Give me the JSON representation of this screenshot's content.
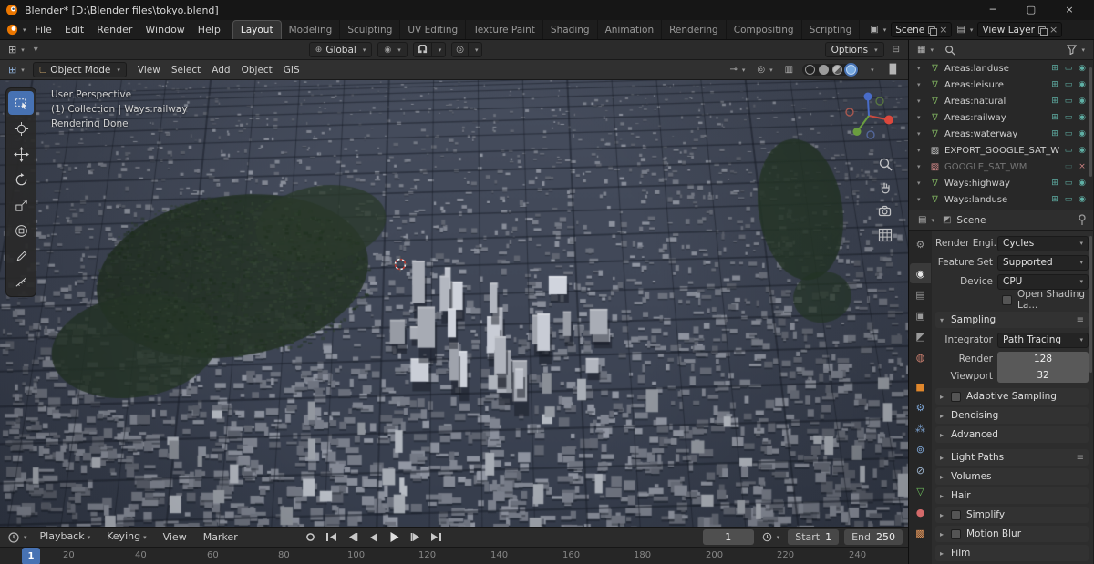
{
  "titlebar": {
    "title": "Blender* [D:\\Blender files\\tokyo.blend]"
  },
  "topbar": {
    "menus": [
      "File",
      "Edit",
      "Render",
      "Window",
      "Help"
    ],
    "workspaces": [
      "Layout",
      "Modeling",
      "Sculpting",
      "UV Editing",
      "Texture Paint",
      "Shading",
      "Animation",
      "Rendering",
      "Compositing",
      "Scripting"
    ],
    "scene_field": "Scene",
    "view_layer_field": "View Layer"
  },
  "tool_header": {
    "orientation": "Global",
    "options": "Options"
  },
  "viewport_header": {
    "mode": "Object Mode",
    "menus": [
      "View",
      "Select",
      "Add",
      "Object",
      "GIS"
    ]
  },
  "viewport_overlay": {
    "line1": "User Perspective",
    "line2": "(1) Collection | Ways:railway",
    "line3": "Rendering Done"
  },
  "outliner": {
    "rows": [
      {
        "label": "Areas:landuse"
      },
      {
        "label": "Areas:leisure"
      },
      {
        "label": "Areas:natural"
      },
      {
        "label": "Areas:railway"
      },
      {
        "label": "Areas:waterway"
      },
      {
        "label": "EXPORT_GOOGLE_SAT_WM"
      },
      {
        "label": "GOOGLE_SAT_WM"
      },
      {
        "label": "Ways:highway"
      },
      {
        "label": "Ways:landuse"
      }
    ]
  },
  "properties": {
    "breadcrumb": "Scene",
    "rows": {
      "render_engine": {
        "label": "Render Engi...",
        "value": "Cycles"
      },
      "feature_set": {
        "label": "Feature Set",
        "value": "Supported"
      },
      "device": {
        "label": "Device",
        "value": "CPU"
      },
      "osl": {
        "label": "Open Shading La..."
      }
    },
    "sampling": {
      "title": "Sampling",
      "integrator_label": "Integrator",
      "integrator": "Path Tracing",
      "render_label": "Render",
      "render_value": "128",
      "viewport_label": "Viewport",
      "viewport_value": "32"
    },
    "sections": [
      {
        "label": "Adaptive Sampling"
      },
      {
        "label": "Denoising"
      },
      {
        "label": "Advanced"
      },
      {
        "label": "Light Paths"
      },
      {
        "label": "Volumes"
      },
      {
        "label": "Hair"
      },
      {
        "label": "Simplify"
      },
      {
        "label": "Motion Blur"
      },
      {
        "label": "Film"
      }
    ]
  },
  "timeline": {
    "menus": [
      "Playback",
      "Keying",
      "View",
      "Marker"
    ],
    "current_frame": "1",
    "start_label": "Start",
    "start_value": "1",
    "end_label": "End",
    "end_value": "250",
    "playhead": "1",
    "ticks": [
      "20",
      "40",
      "60",
      "80",
      "100",
      "120",
      "140",
      "160",
      "180",
      "200",
      "220",
      "240"
    ]
  }
}
